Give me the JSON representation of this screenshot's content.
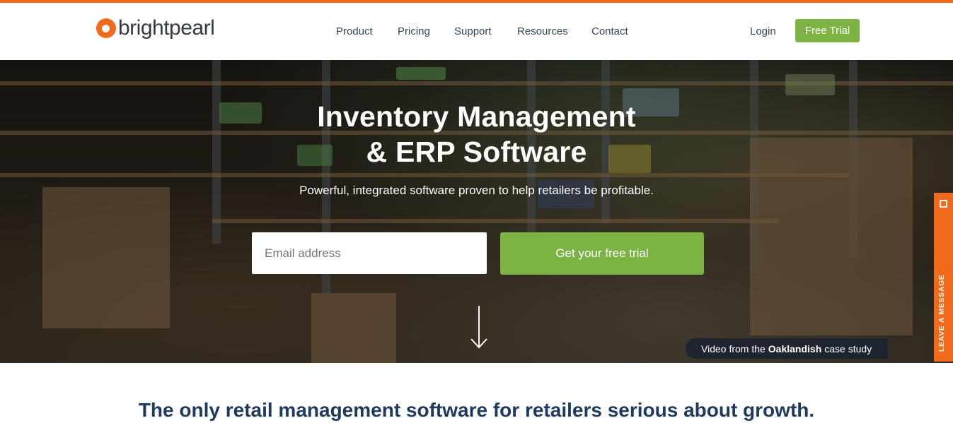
{
  "brand": {
    "name": "brightpearl",
    "accent": "#f26b1d",
    "green": "#7cb342"
  },
  "nav": {
    "items": [
      "Product",
      "Pricing",
      "Support",
      "Resources",
      "Contact"
    ],
    "login": "Login",
    "free_trial": "Free Trial"
  },
  "hero": {
    "title_line1": "Inventory Management",
    "title_line2": "& ERP Software",
    "subtitle": "Powerful, integrated software proven to help retailers be profitable.",
    "email_placeholder": "Email address",
    "cta": "Get your free trial",
    "caption_prefix": "Video from the",
    "caption_bold": "Oaklandish",
    "caption_suffix": "case study"
  },
  "widget": {
    "label": "LEAVE A MESSAGE"
  },
  "tagline": "The only retail management software for retailers serious about growth."
}
